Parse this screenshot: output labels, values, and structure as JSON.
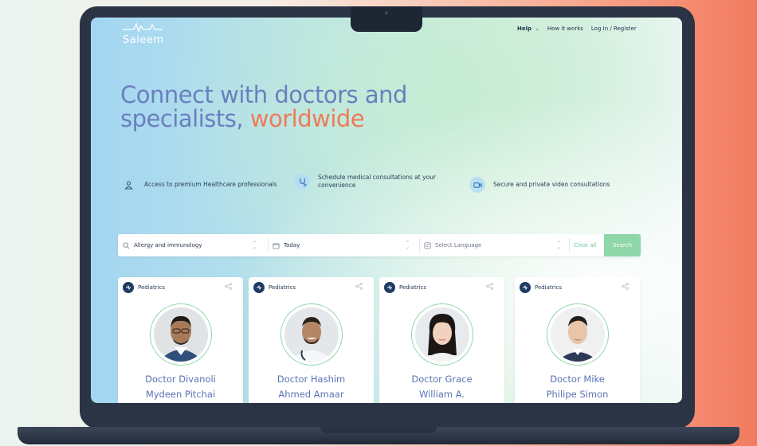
{
  "brand": {
    "name": "Saleem"
  },
  "nav": {
    "help": "Help",
    "how_it_works": "How it works",
    "login": "Log In / Register"
  },
  "hero": {
    "line1": "Connect with doctors and",
    "line2_start": "specialists, ",
    "line2_accent": "worldwide",
    "accent_color": "#ee7a58"
  },
  "features": [
    {
      "text": "Access to premium Healthcare professionals",
      "icon": "doctor-icon"
    },
    {
      "text_line1": "Schedule medical consultations at your",
      "text_line2": "convenience",
      "icon": "stethoscope-icon"
    },
    {
      "text": "Secure and private video consultations",
      "icon": "video-icon"
    }
  ],
  "search": {
    "specialty": "Allergy and immunology",
    "date": "Today",
    "language_placeholder": "Select Language",
    "clear_label": "Clear all",
    "search_label": "Search"
  },
  "doctors": [
    {
      "specialty": "Pediatrics",
      "name_line1": "Doctor Divanoli",
      "name_line2": "Mydeen Pitchai"
    },
    {
      "specialty": "Pediatrics",
      "name_line1": "Doctor Hashim",
      "name_line2": "Ahmed Amaar"
    },
    {
      "specialty": "Pediatrics",
      "name_line1": "Doctor Grace",
      "name_line2": "William A."
    },
    {
      "specialty": "Pediatrics",
      "name_line1": "Doctor Mike",
      "name_line2": "Philipe Simon"
    }
  ],
  "colors": {
    "accent_green": "#8fd6a8",
    "hero_blue": "#6a7fbd",
    "spec_badge": "#1f3b63"
  }
}
